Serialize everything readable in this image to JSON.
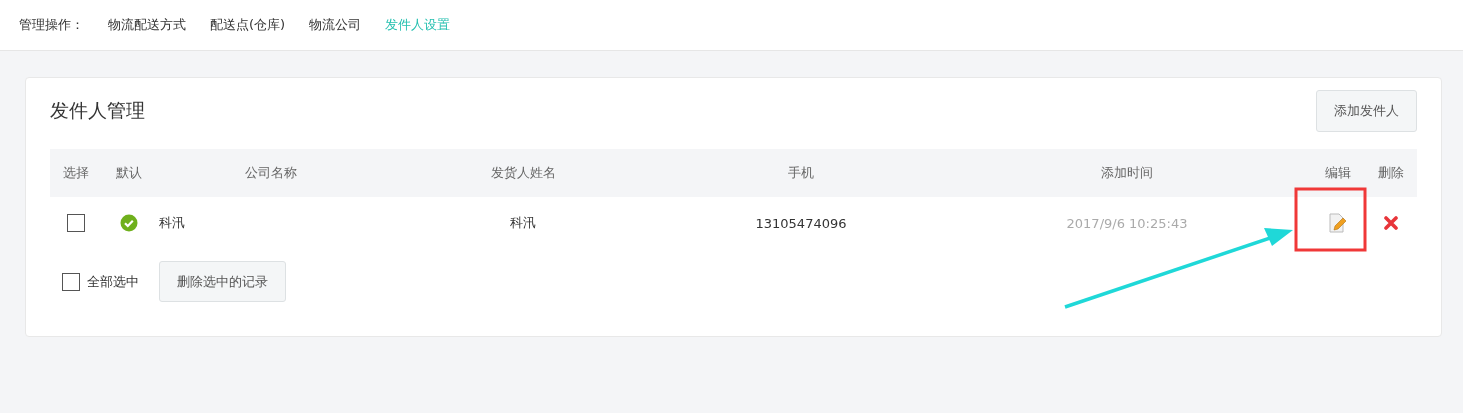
{
  "nav": {
    "label": "管理操作：",
    "items": [
      {
        "label": "物流配送方式",
        "selected": false
      },
      {
        "label": "配送点(仓库)",
        "selected": false
      },
      {
        "label": "物流公司",
        "selected": false
      },
      {
        "label": "发件人设置",
        "selected": true
      }
    ]
  },
  "panel": {
    "title": "发件人管理",
    "add_button": "添加发件人"
  },
  "table": {
    "columns": [
      "选择",
      "默认",
      "公司名称",
      "发货人姓名",
      "手机",
      "添加时间",
      "编辑",
      "删除"
    ],
    "rows": [
      {
        "checked": false,
        "default": true,
        "company": "科汛",
        "sender": "科汛",
        "phone": "13105474096",
        "added": "2017/9/6 10:25:43"
      }
    ]
  },
  "select_all": {
    "label": "全部选中",
    "checked": false
  },
  "delete_selected": "删除选中的记录"
}
